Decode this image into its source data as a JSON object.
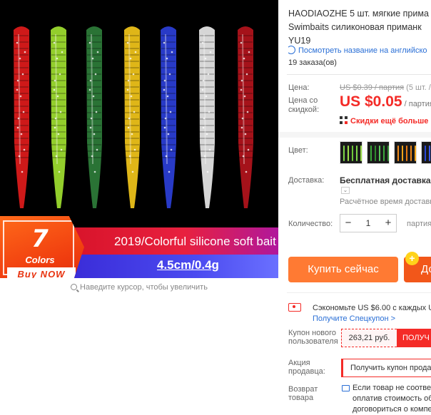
{
  "gallery": {
    "promo_number": "7",
    "promo_colors": "Colors",
    "promo_buy": "Buy NOW",
    "banner_text": "2019/Colorful silicone soft bait",
    "banner_size": "4.5cm/0.4g",
    "zoom_hint": "Наведите курсор, чтобы увеличить",
    "worm_colors": [
      "#e01b1b",
      "#9fe030",
      "#2e7d3a",
      "#f2c51a",
      "#2b3fd8",
      "#e8e8e8",
      "#b3141c"
    ]
  },
  "product": {
    "title_lines": [
      "HAODIAOZHE 5 шт. мягкие прима",
      "Swimbaits силиконовая приманк",
      "YU19"
    ],
    "translate_link": "Посмотреть название на английско",
    "orders": "19 заказа(ов)"
  },
  "price": {
    "label": "Цена:",
    "old_price": "US $0.39 / партия",
    "old_price_extra": " (5 шт. /",
    "discount_label_line1": "Цена со",
    "discount_label_line2": "скидкой:",
    "new_price": "US $0.05",
    "new_price_unit": " / партия",
    "discount_text": "Скидки ещё больше в"
  },
  "options": {
    "color_label": "Цвет:",
    "swatch_colors": [
      [
        "#7fd84a",
        "#9be04a",
        "#6fc83a"
      ],
      [
        "#3aa83a",
        "#2e8a2e",
        "#5ac85a"
      ],
      [
        "#f08a1a",
        "#f2a51a",
        "#e87a10"
      ],
      [
        "#2a4ad8",
        "#3a5af0",
        "#203ac0"
      ]
    ],
    "shipping_label": "Доставка:",
    "shipping_main": "Бесплатная доставка в Р",
    "shipping_sub": "Расчётное время доставк",
    "quantity_label": "Количество:",
    "quantity_value": "1",
    "quantity_minus": "−",
    "quantity_plus": "+",
    "quantity_note": "партия"
  },
  "actions": {
    "buy_now": "Купить сейчас",
    "add_to_cart": "До",
    "cart_plus": "+"
  },
  "coupons": {
    "save_text": "Сэкономьте US $6.00 с каждых US",
    "save_link": "Получите Спецкупон >",
    "new_user_label_1": "Купон нового",
    "new_user_label_2": "пользователя",
    "new_user_amount": "263,21 руб.",
    "new_user_button": "ПОЛУЧ",
    "seller_label_1": "Акция",
    "seller_label_2": "продавца:",
    "seller_button": "Получить купон продав",
    "return_label_1": "Возврат",
    "return_label_2": "товара",
    "return_lines": [
      "Если товар не соответ",
      "оплатив стоимость об",
      "договориться о компе"
    ]
  }
}
